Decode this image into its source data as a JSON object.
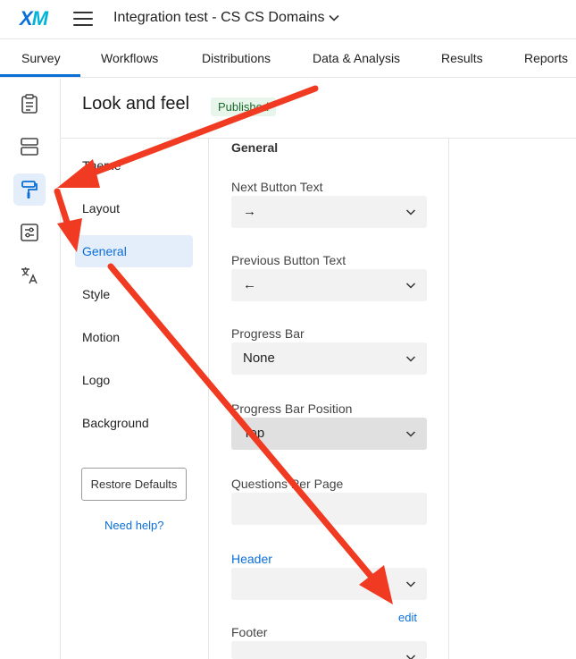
{
  "app": {
    "logo": {
      "x_letter": "X",
      "m_letter": "M"
    },
    "project_title": "Integration test - CS CS Domains"
  },
  "nav_tabs": [
    {
      "label": "Survey",
      "active": true
    },
    {
      "label": "Workflows",
      "active": false
    },
    {
      "label": "Distributions",
      "active": false
    },
    {
      "label": "Data & Analysis",
      "active": false
    },
    {
      "label": "Results",
      "active": false
    },
    {
      "label": "Reports",
      "active": false
    }
  ],
  "left_rail": [
    {
      "icon": "clipboard-icon",
      "active": false
    },
    {
      "icon": "blocks-icon",
      "active": false
    },
    {
      "icon": "paint-roller-icon",
      "active": true
    },
    {
      "icon": "sliders-icon",
      "active": false
    },
    {
      "icon": "translate-icon",
      "active": false
    }
  ],
  "page": {
    "title": "Look and feel",
    "status_badge": "Published"
  },
  "section_nav": {
    "items": [
      {
        "label": "Theme",
        "active": false
      },
      {
        "label": "Layout",
        "active": false
      },
      {
        "label": "General",
        "active": true
      },
      {
        "label": "Style",
        "active": false
      },
      {
        "label": "Motion",
        "active": false
      },
      {
        "label": "Logo",
        "active": false
      },
      {
        "label": "Background",
        "active": false
      }
    ],
    "restore_button": "Restore Defaults",
    "help_link": "Need help?"
  },
  "general_panel": {
    "heading": "General",
    "next_button": {
      "label": "Next Button Text",
      "value": "→"
    },
    "previous_button": {
      "label": "Previous Button Text",
      "value": "←"
    },
    "progress_bar": {
      "label": "Progress Bar",
      "value": "None"
    },
    "progress_bar_position": {
      "label": "Progress Bar Position",
      "value": "Top"
    },
    "questions_per_page": {
      "label": "Questions Per Page",
      "value": ""
    },
    "header": {
      "label": "Header",
      "value": "",
      "edit_link": "edit"
    },
    "footer": {
      "label": "Footer",
      "value": ""
    }
  },
  "colors": {
    "accent": "#0b6fd8",
    "annotation_arrow": "#f03a22",
    "badge_bg": "#e8f5ea"
  }
}
